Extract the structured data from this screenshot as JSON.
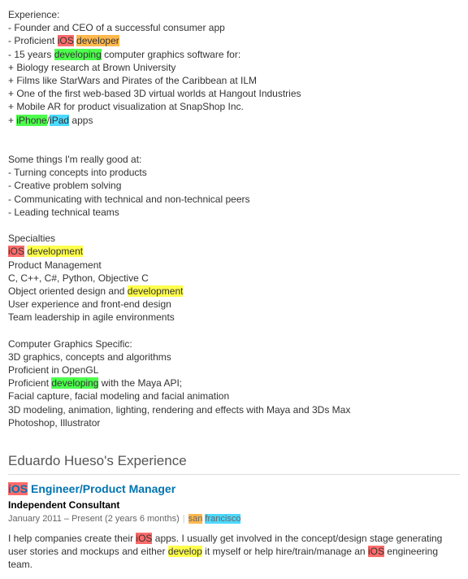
{
  "summary": {
    "experience_label": "Experience:",
    "bullets": {
      "b1": "- Founder and CEO of a successful consumer app",
      "b2_pre": "- Proficient ",
      "b2_ios": "iOS",
      "b2_sp": " ",
      "b2_dev": "developer",
      "b3_pre": "- 15 years ",
      "b3_dev": "developing",
      "b3_post": " computer graphics software for:",
      "b4": "+ Biology research at Brown University",
      "b5": "+ Films like StarWars and Pirates of the Caribbean at ILM",
      "b6": "+ One of the first web-based 3D virtual worlds at Hangout Industries",
      "b7": "+ Mobile AR for product visualization at SnapShop Inc.",
      "b8_pre": "+ ",
      "b8_iphone": "iPhone",
      "b8_slash": "/",
      "b8_ipad": "iPad",
      "b8_post": " apps"
    },
    "good_at_label": "Some things I'm really good at:",
    "good_at": {
      "g1": "- Turning concepts into products",
      "g2": "- Creative problem solving",
      "g3": "- Communicating with technical and non-technical peers",
      "g4": "- Leading technical teams"
    },
    "specialties_label": "Specialties",
    "spec": {
      "s1_ios": "iOS",
      "s1_sp": " ",
      "s1_dev": "development",
      "s2": "Product Management",
      "s3": "C, C++, C#, Python, Objective C",
      "s4_pre": "Object oriented design and ",
      "s4_dev": "development",
      "s5": "User experience and front-end design",
      "s6": "Team leadership in agile environments"
    },
    "cg_label": "Computer Graphics Specific:",
    "cg": {
      "c1": "3D graphics, concepts and algorithms",
      "c2": "Proficient in OpenGL",
      "c3_pre": "Proficient ",
      "c3_dev": "developing",
      "c3_post": " with the Maya API;",
      "c4": "Facial capture, facial modeling and facial animation",
      "c5": "3D modeling, animation, lighting, rendering and effects with Maya and 3Ds Max",
      "c6": "Photoshop, Illustrator"
    }
  },
  "experience_section": {
    "heading": "Eduardo Hueso's Experience",
    "job": {
      "title_ios": "iOS",
      "title_rest": " Engineer/Product Manager",
      "company": "Independent Consultant",
      "dates": "January 2011 – Present (2 years 6 months)",
      "loc_san": "san",
      "loc_sp": " ",
      "loc_fran": "francisco",
      "desc_1": "I help companies create their ",
      "desc_ios1": "iOS",
      "desc_2": " apps. I usually get involved in the concept/design stage generating user stories and mockups and either ",
      "desc_dev": "develop",
      "desc_3": " it myself or help hire/train/manage an ",
      "desc_ios2": "iOS",
      "desc_4": " engineering team."
    }
  }
}
